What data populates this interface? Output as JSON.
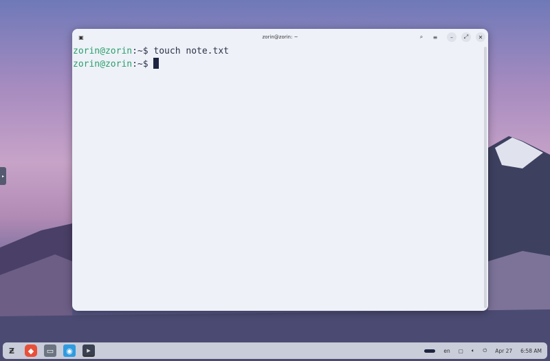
{
  "window": {
    "title": "zorin@zorin: ~"
  },
  "terminal": {
    "lines": [
      {
        "prompt_user": "zorin@zorin",
        "prompt_path": ":~$",
        "command": " touch note.txt"
      },
      {
        "prompt_user": "zorin@zorin",
        "prompt_path": ":~$",
        "command": " "
      }
    ]
  },
  "taskbar": {
    "apps": [
      "zorin-menu",
      "brave-browser",
      "files",
      "software-store",
      "terminal"
    ],
    "tray": {
      "lang": "en",
      "date": "Apr 27",
      "time": "6:58 AM"
    }
  },
  "colors": {
    "prompt_green": "#2aa06a",
    "terminal_bg": "#eef1f8"
  }
}
